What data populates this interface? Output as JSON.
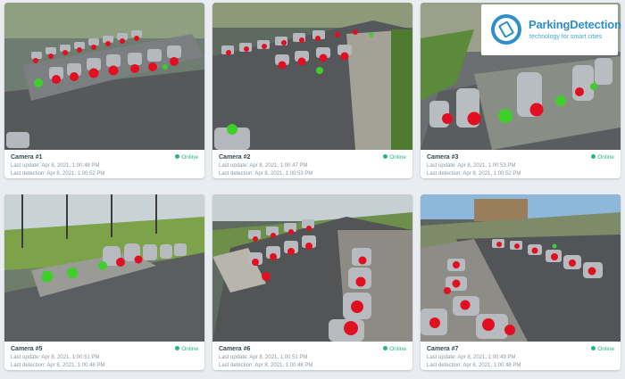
{
  "cameras": [
    {
      "title": "Camera #1",
      "status": "Online",
      "last_update": "Last update: Apr 8, 2021, 1:00:48 PM",
      "last_detection": "Last detection: Apr 8, 2021, 1:00:52 PM"
    },
    {
      "title": "Camera #2",
      "status": "Online",
      "last_update": "Last update: Apr 8, 2021, 1:00:47 PM",
      "last_detection": "Last detection: Apr 8, 2021, 1:00:53 PM"
    },
    {
      "title": "Camera #3",
      "status": "Online",
      "last_update": "Last update: Apr 8, 2021, 1:00:53 PM",
      "last_detection": "Last detection: Apr 8, 2021, 1:00:52 PM"
    },
    {
      "title": "Camera #5",
      "status": "Online",
      "last_update": "Last update: Apr 8, 2021, 1:00:51 PM",
      "last_detection": "Last detection: Apr 8, 2021, 1:00:48 PM"
    },
    {
      "title": "Camera #6",
      "status": "Online",
      "last_update": "Last update: Apr 8, 2021, 1:00:51 PM",
      "last_detection": "Last detection: Apr 8, 2021, 1:00:48 PM"
    },
    {
      "title": "Camera #7",
      "status": "Online",
      "last_update": "Last update: Apr 8, 2021, 1:00:49 PM",
      "last_detection": "Last detection: Apr 8, 2021, 1:00:48 PM"
    }
  ],
  "brand": {
    "name": "ParkingDetection",
    "tagline": "technology for smart cities"
  },
  "colors": {
    "occupied": "#e01020",
    "free": "#3ecf2a",
    "online": "#26b67f",
    "brand": "#2e8ec9"
  }
}
